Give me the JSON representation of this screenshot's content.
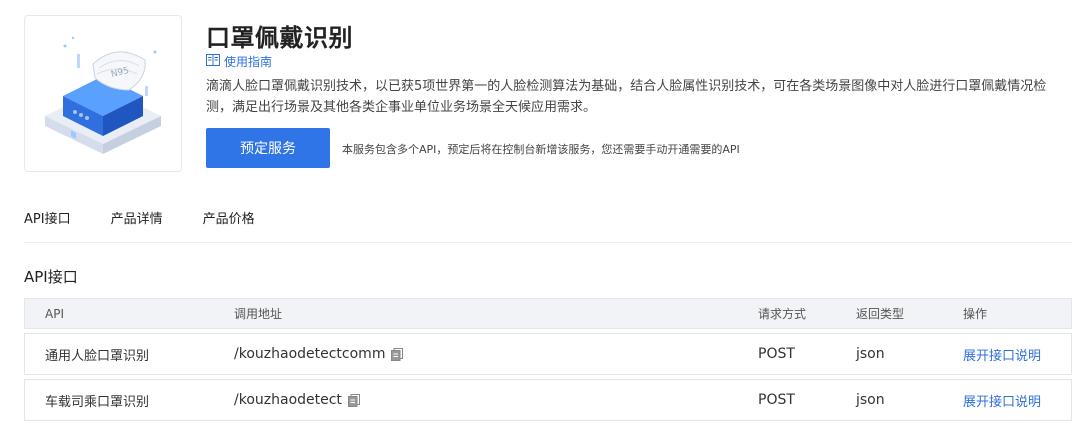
{
  "product": {
    "title": "口罩佩戴识别",
    "image_label": "N95",
    "guide_label": "使用指南",
    "description": "滴滴人脸口罩佩戴识别技术，以已获5项世界第一的人脸检测算法为基础，结合人脸属性识别技术，可在各类场景图像中对人脸进行口罩佩戴情况检测，满足出行场景及其他各类企事业单位业务场景全天候应用需求。",
    "book_button": "预定服务",
    "note": "本服务包含多个API，预定后将在控制台新增该服务，您还需要手动开通需要的API"
  },
  "tabs": [
    "API接口",
    "产品详情",
    "产品价格"
  ],
  "section_title": "API接口",
  "table": {
    "headers": [
      "API",
      "调用地址",
      "请求方式",
      "返回类型",
      "操作"
    ],
    "rows": [
      {
        "name": "通用人脸口罩识别",
        "path": "/kouzhaodetectcomm",
        "method": "POST",
        "type": "json",
        "action": "展开接口说明"
      },
      {
        "name": "车载司乘口罩识别",
        "path": "/kouzhaodetect",
        "method": "POST",
        "type": "json",
        "action": "展开接口说明"
      }
    ]
  },
  "icons": {
    "guide": "book-icon",
    "copy": "copy-icon"
  },
  "colors": {
    "primary": "#2f75e8",
    "link": "#2f6fde"
  }
}
